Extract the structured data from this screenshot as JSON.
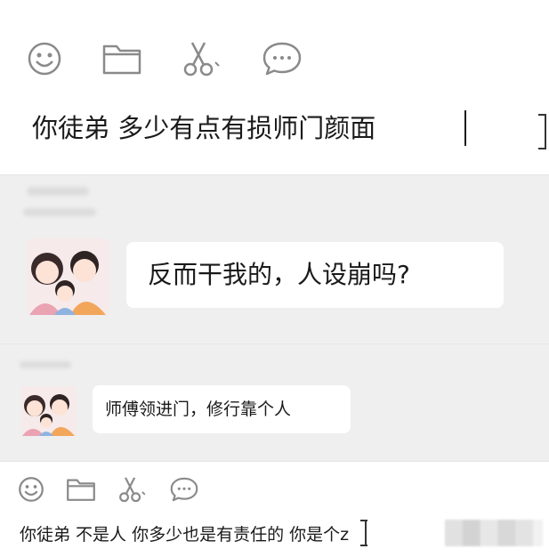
{
  "top_compose": {
    "toolbar": [
      "emoji-icon",
      "folder-icon",
      "scissors-icon",
      "chat-bubble-icon"
    ],
    "input_text": "你徒弟  多少有点有损师门颜面"
  },
  "messages": [
    {
      "avatar": "couple-avatar",
      "text": "反而干我的，人设崩吗?"
    },
    {
      "avatar": "couple-avatar",
      "text": "师傅领进门，修行靠个人"
    }
  ],
  "bottom_compose": {
    "toolbar": [
      "emoji-icon",
      "folder-icon",
      "scissors-icon",
      "chat-bubble-icon"
    ],
    "input_text": "你徒弟 不是人  你多少也是有责任的  你是个z"
  },
  "colors": {
    "window_bg": "#ffffff",
    "chat_bg": "#efefef",
    "bubble_bg": "#ffffff",
    "icon_stroke": "#8a8a8a",
    "text": "#1a1a1a"
  }
}
